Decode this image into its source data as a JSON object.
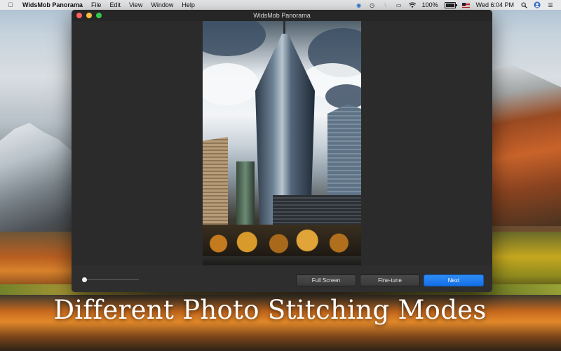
{
  "menubar": {
    "app_name": "WidsMob Panorama",
    "menus": [
      "File",
      "Edit",
      "View",
      "Window",
      "Help"
    ],
    "battery_percent": "100%",
    "battery_level": 1.0,
    "clock": "Wed 6:04 PM",
    "status_icons": [
      "globe-icon",
      "time-machine-icon",
      "bluetooth-icon",
      "display-icon",
      "wifi-icon",
      "battery-icon",
      "flag-icon",
      "search-icon",
      "user-icon",
      "list-icon"
    ]
  },
  "window": {
    "title": "WidsMob Panorama"
  },
  "toolbar": {
    "slider_value": 0,
    "fullscreen_label": "Full Screen",
    "finetune_label": "Fine-tune",
    "next_label": "Next"
  },
  "caption": "Different Photo Stitching Modes",
  "colors": {
    "accent": "#1e7cf0",
    "window_bg": "#2f2f2f"
  }
}
